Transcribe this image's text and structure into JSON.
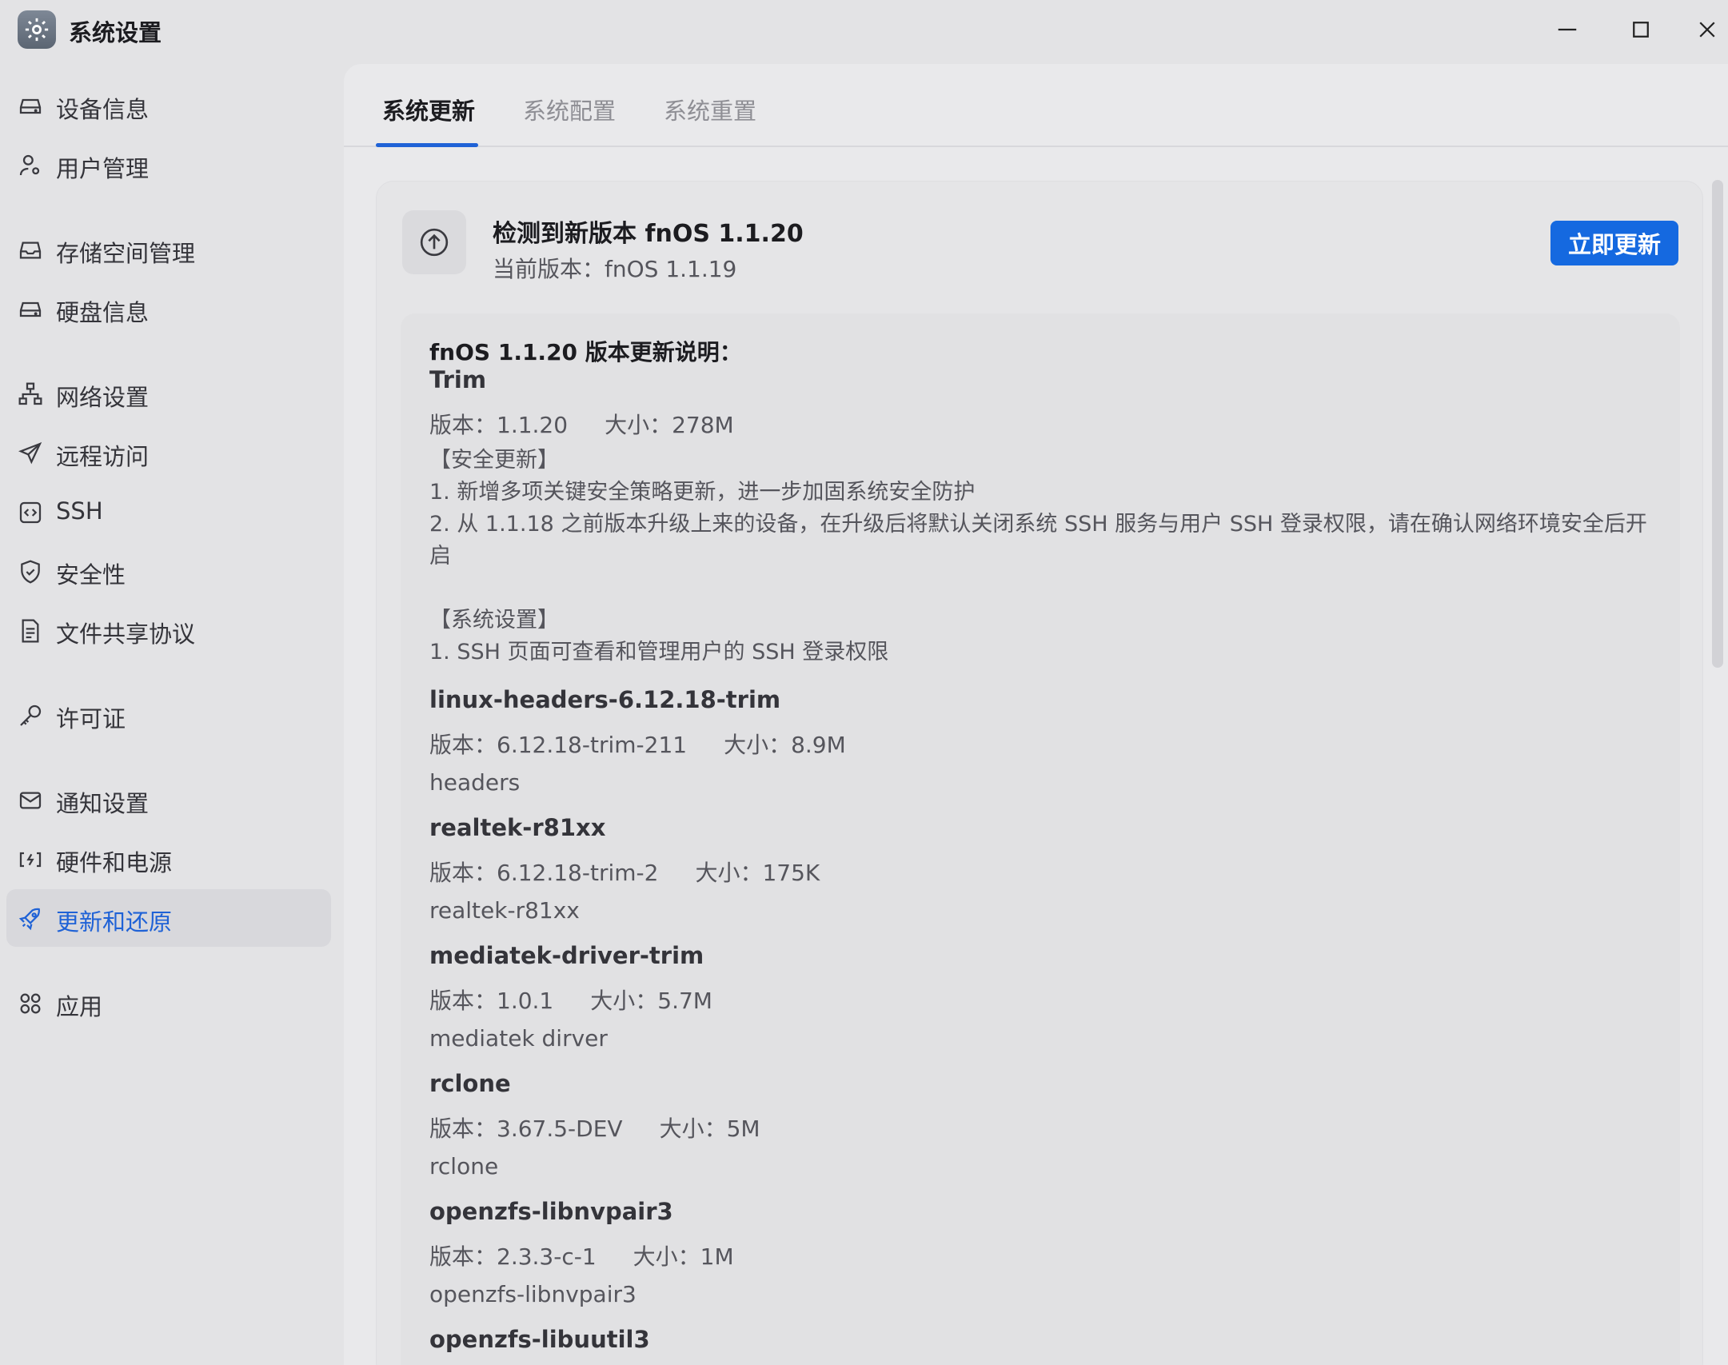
{
  "window": {
    "title": "系统设置",
    "icons": {
      "app": "gear-icon",
      "minimize": "minimize-icon",
      "maximize": "maximize-icon",
      "close": "close-icon"
    }
  },
  "sidebar": {
    "items": [
      {
        "label": "设备信息",
        "icon": "drive-icon"
      },
      {
        "label": "用户管理",
        "icon": "user-settings-icon"
      },
      {
        "label": "存储空间管理",
        "icon": "inbox-tray-icon"
      },
      {
        "label": "硬盘信息",
        "icon": "drive-icon"
      },
      {
        "label": "网络设置",
        "icon": "network-icon"
      },
      {
        "label": "远程访问",
        "icon": "send-icon"
      },
      {
        "label": "SSH",
        "icon": "code-box-icon"
      },
      {
        "label": "安全性",
        "icon": "shield-icon"
      },
      {
        "label": "文件共享协议",
        "icon": "document-icon"
      },
      {
        "label": "许可证",
        "icon": "key-icon"
      },
      {
        "label": "通知设置",
        "icon": "mail-icon"
      },
      {
        "label": "硬件和电源",
        "icon": "power-plug-icon"
      },
      {
        "label": "更新和还原",
        "icon": "rocket-icon",
        "active": true
      },
      {
        "label": "应用",
        "icon": "apps-grid-icon"
      }
    ]
  },
  "tabs": [
    {
      "label": "系统更新",
      "active": true
    },
    {
      "label": "系统配置"
    },
    {
      "label": "系统重置"
    }
  ],
  "update": {
    "title": "检测到新版本 fnOS 1.1.20",
    "current": "当前版本：fnOS 1.1.19",
    "button": "立即更新",
    "icon": "arrow-up-circle-icon"
  },
  "notes": {
    "heading": "fnOS 1.1.20 版本更新说明：",
    "trim": {
      "name": "Trim",
      "version": "版本：1.1.20",
      "size": "大小：278M",
      "security_header": "【安全更新】",
      "security_1": "1. 新增多项关键安全策略更新，进一步加固系统安全防护",
      "security_2": "2. 从 1.1.18 之前版本升级上来的设备，在升级后将默认关闭系统 SSH 服务与用户 SSH 登录权限，请在确认网络环境安全后开启",
      "system_header": "【系统设置】",
      "system_1": "1. SSH 页面可查看和管理用户的 SSH 登录权限"
    },
    "packages": [
      {
        "name": "linux-headers-6.12.18-trim",
        "version": "版本：6.12.18-trim-211",
        "size": "大小：8.9M",
        "desc": "headers"
      },
      {
        "name": "realtek-r81xx",
        "version": "版本：6.12.18-trim-2",
        "size": "大小：175K",
        "desc": "realtek-r81xx"
      },
      {
        "name": "mediatek-driver-trim",
        "version": "版本：1.0.1",
        "size": "大小：5.7M",
        "desc": "mediatek dirver"
      },
      {
        "name": "rclone",
        "version": "版本：3.67.5-DEV",
        "size": "大小：5M",
        "desc": "rclone"
      },
      {
        "name": "openzfs-libnvpair3",
        "version": "版本：2.3.3-c-1",
        "size": "大小：1M",
        "desc": "openzfs-libnvpair3"
      },
      {
        "name": "openzfs-libuutil3",
        "version": "",
        "size": "",
        "desc": ""
      }
    ]
  },
  "colors": {
    "accent": "#1569e0",
    "active_nav_text": "#1f62d6",
    "background": "#e3e3e5"
  }
}
